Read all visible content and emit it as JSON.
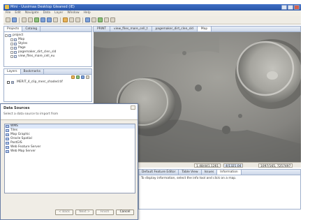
{
  "window": {
    "title": "Mini - Uusimaa Desktop Gleaned (IE)"
  },
  "menu": [
    "File",
    "Edit",
    "Navigate",
    "Data",
    "Layer",
    "Window",
    "Help"
  ],
  "left_panel": {
    "tabs": [
      "Projects",
      "Catalog"
    ],
    "tree": [
      "project",
      "Map",
      "Styles",
      "Page",
      "pagemaker_dirt_clen_sld",
      "view_files_mare_cell_eu"
    ]
  },
  "layers_panel": {
    "tabs": [
      "Layers",
      "Bookmarks"
    ],
    "items": [
      "MERIT_4_clip_merc_shaded.tif"
    ]
  },
  "editor_tabs": [
    "PRINT",
    "view_files_mare_cell_t",
    "pagemaker_dirt_clen_sld",
    "Map"
  ],
  "status_bar": {
    "coords": "1.48/441.1261",
    "scale": "4/1321.04",
    "crs": "1097/165, 7257497"
  },
  "bottom_panel": {
    "tabs": [
      "Default Feature Editor",
      "Table View",
      "Issues",
      "Information"
    ],
    "message": "To display information, select the info tool and click on a map."
  },
  "dialog": {
    "title": "Data Sources",
    "subtitle": "Select a data source to import from",
    "items": [
      "WMS",
      "Tiles",
      "Map Graphic",
      "Oracle Spatial",
      "PostGIS",
      "Web Feature Server",
      "Web Map Server"
    ],
    "buttons": {
      "back": "< Back",
      "next": "Next >",
      "finish": "Finish",
      "cancel": "Cancel"
    }
  },
  "colors": {
    "titlebar": "#2a56a8",
    "selection": "#dde8fa",
    "map_ground": "#7b7b78"
  }
}
